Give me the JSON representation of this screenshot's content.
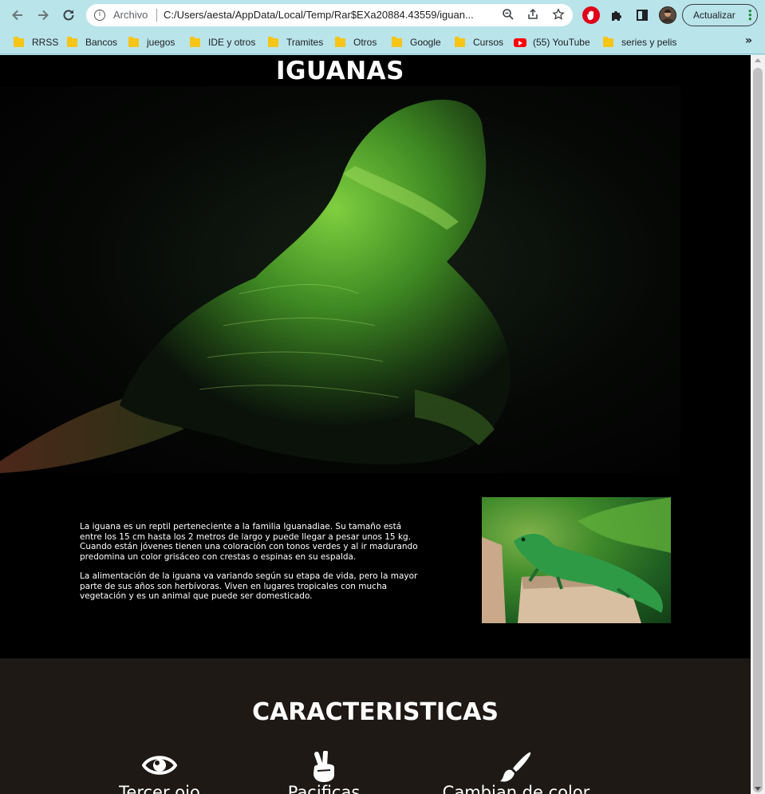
{
  "browser": {
    "back_icon": "arrow-left-icon",
    "forward_icon": "arrow-right-icon",
    "reload_icon": "reload-icon",
    "address": {
      "scheme_label": "Archivo",
      "url": "C:/Users/aesta/AppData/Local/Temp/Rar$EXa20884.43559/iguan..."
    },
    "update_button_label": "Actualizar",
    "bookmarks": [
      {
        "label": "RRSS",
        "icon": "folder-icon"
      },
      {
        "label": "Bancos",
        "icon": "folder-icon"
      },
      {
        "label": "juegos",
        "icon": "folder-icon"
      },
      {
        "label": "IDE y otros",
        "icon": "folder-icon"
      },
      {
        "label": "Tramites",
        "icon": "folder-icon"
      },
      {
        "label": "Otros",
        "icon": "folder-icon"
      },
      {
        "label": "Google",
        "icon": "folder-icon"
      },
      {
        "label": "Cursos",
        "icon": "folder-icon"
      },
      {
        "label": "(55) YouTube",
        "icon": "youtube-icon"
      },
      {
        "label": "series y pelis",
        "icon": "folder-icon"
      }
    ],
    "bookmarks_more": "»"
  },
  "page": {
    "title": "IGUANAS",
    "intro": [
      "La iguana es un reptil perteneciente a la familia Iguanadiae. Su tamaño está entre los 15 cm hasta los 2 metros de largo y puede llegar a pesar unos 15 kg. Cuando están jóvenes tienen una coloración con tonos verdes y al ir madurando predomina un color grisáceo con crestas o espinas en su espalda.",
      "La alimentación de la iguana va variando según su etapa de vida, pero la mayor parte de sus años son herbívoras. Viven en lugares tropicales con mucha vegetación y es un animal que puede ser domesticado."
    ],
    "features_title": "CARACTERISTICAS",
    "features": [
      {
        "label": "Tercer ojo",
        "icon": "eye-icon"
      },
      {
        "label": "Pacificas",
        "icon": "peace-hand-icon"
      },
      {
        "label": "Cambian de color",
        "icon": "paintbrush-icon"
      }
    ]
  },
  "colors": {
    "chrome": "#b9e4ea",
    "page_bg": "#000000",
    "features_bg": "#1e1915",
    "text": "#ffffff"
  }
}
